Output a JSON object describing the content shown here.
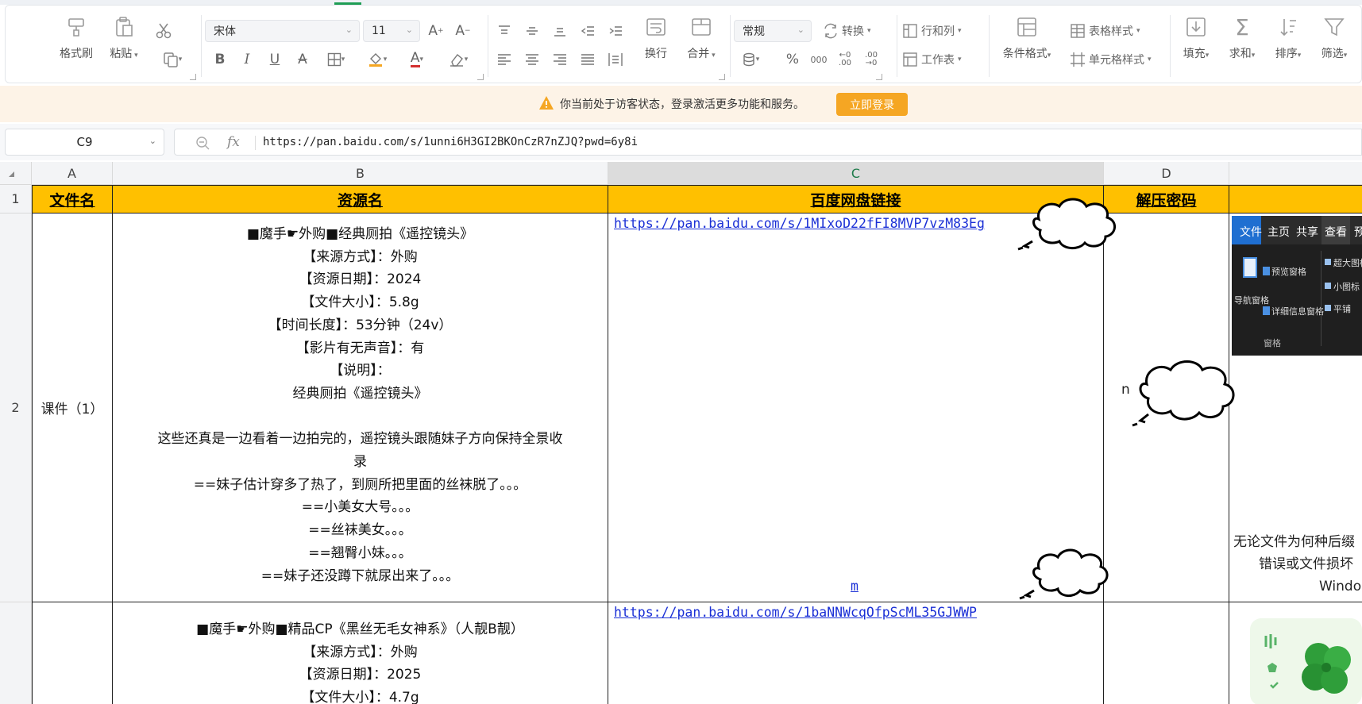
{
  "ribbon": {
    "format_painter": "格式刷",
    "paste": "粘贴",
    "font_name": "宋体",
    "font_size": "11",
    "wrap": "换行",
    "merge": "合并",
    "number_format": "常规",
    "convert": "转换",
    "row_col": "行和列",
    "worksheet": "工作表",
    "cond_format": "条件格式",
    "table_style": "表格样式",
    "cell_style": "单元格样式",
    "fill": "填充",
    "sum": "求和",
    "sort": "排序",
    "filter": "筛选",
    "percent": "%",
    "thousands": "000"
  },
  "notice": {
    "message": "你当前处于访客状态，登录激活更多功能和服务。",
    "login_button": "立即登录"
  },
  "formula_bar": {
    "cell_ref": "C9",
    "fx": "fx",
    "value": "https://pan.baidu.com/s/1unni6H3GI2BKOnCzR7nZJQ?pwd=6y8i"
  },
  "sheet": {
    "columns": [
      "A",
      "B",
      "C",
      "D"
    ],
    "rows": [
      "1",
      "2"
    ],
    "header": {
      "file_name": "文件名",
      "resource_name": "资源名",
      "baidu_link": "百度网盘链接",
      "password": "解压密码"
    },
    "row2": {
      "file": "课件（1）",
      "desc": [
        "■魔手☛外购■经典厕拍《遥控镜头》",
        "【来源方式】：外购",
        "【资源日期】：2024",
        "【文件大小】：5.8g",
        "【时间长度】：53分钟（24v）",
        "【影片有无声音】：有",
        "【说明】：",
        "经典厕拍《遥控镜头》",
        "",
        "这些还真是一边看着一边拍完的，遥控镜头跟随妹子方向保持全景收",
        "录",
        "==妹子估计穿多了热了，到厕所把里面的丝袜脱了。。。",
        "==小美女大号。。。",
        "==丝袜美女。。。",
        "==翘臀小妹。。。",
        "==妹子还没蹲下就尿出来了。。。"
      ],
      "link": "https://pan.baidu.com/s/1MIxoD22fFI8MVP7vzM83Eg",
      "link_tail": "m",
      "password_partial": "n",
      "e_text": [
        "无论文件为何种后缀",
        "错误或文件损坏",
        "Windo"
      ],
      "explorer": {
        "tabs": [
          "文件",
          "主页",
          "共享",
          "查看",
          "预"
        ],
        "nav_pane": "导航窗格",
        "preview_pane": "预览窗格",
        "details_pane": "详细信息窗格",
        "xl_icons": "超大图标",
        "small_icons": "小图标",
        "tiles": "平铺",
        "group": "窗格"
      }
    },
    "row3": {
      "desc": [
        "■魔手☛外购■精品CP《黑丝无毛女神系》（人靓B靓）",
        "【来源方式】：外购",
        "【资源日期】：2025",
        "【文件大小】：4.7g"
      ],
      "link": "https://pan.baidu.com/s/1baNNWcqOfpScML35GJWWP"
    }
  }
}
